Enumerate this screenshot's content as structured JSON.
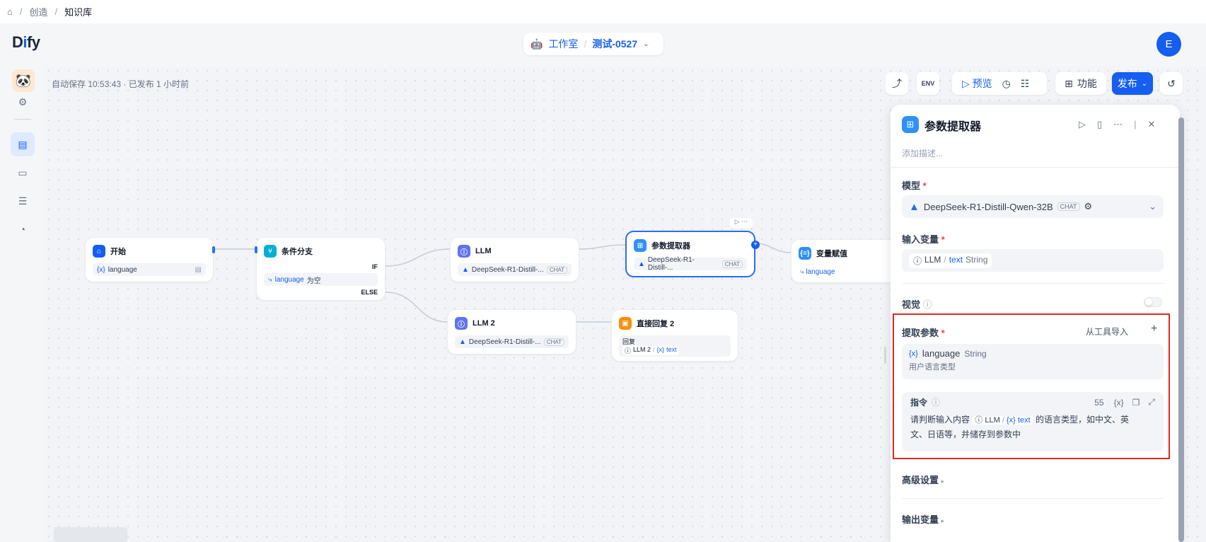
{
  "breadcrumb": {
    "items": [
      "创造",
      "知识库"
    ]
  },
  "header": {
    "logo_pre": "D",
    "logo_i": "i",
    "logo_post": "fy",
    "workspace": "工作室",
    "app_name": "测试-0527",
    "avatar": "E"
  },
  "toolbar": {
    "autosave": "自动保存 10:53:43 · 已发布 1 小时前",
    "env": "ENV",
    "preview": "预览",
    "features": "功能",
    "publish": "发布"
  },
  "nodes": {
    "start": {
      "title": "开始",
      "var": "language"
    },
    "if": {
      "title": "条件分支",
      "cond_var": "language",
      "cond_op": "为空",
      "if_label": "IF",
      "else_label": "ELSE"
    },
    "llm": {
      "title": "LLM",
      "model": "DeepSeek-R1-Distill-...",
      "tag": "CHAT"
    },
    "param": {
      "title": "参数提取器",
      "model": "DeepSeek-R1-Distill-...",
      "tag": "CHAT"
    },
    "assign": {
      "title": "变量赋值",
      "var": "language"
    },
    "llm2": {
      "title": "LLM 2",
      "model": "DeepSeek-R1-Distill-...",
      "tag": "CHAT"
    },
    "reply": {
      "title": "直接回复 2",
      "label": "回复",
      "src": "LLM 2",
      "var": "text"
    }
  },
  "panel": {
    "title": "参数提取器",
    "desc_placeholder": "添加描述...",
    "model_label": "模型",
    "model_name": "DeepSeek-R1-Distill-Qwen-32B",
    "model_tag": "CHAT",
    "input_label": "输入变量",
    "input_src": "LLM",
    "input_var": "text",
    "input_type": "String",
    "vision_label": "视觉",
    "extract_label": "提取参数",
    "import_tool": "从工具导入",
    "param_name": "language",
    "param_type": "String",
    "param_desc": "用户语言类型",
    "instr_label": "指令",
    "instr_count": "55",
    "instr_pre": "请判断输入内容",
    "instr_src": "LLM",
    "instr_var": "text",
    "instr_post": "的语言类型，如中文、英",
    "instr_line2": "文、日语等，并储存到参数中",
    "advanced": "高级设置",
    "output": "输出变量"
  }
}
